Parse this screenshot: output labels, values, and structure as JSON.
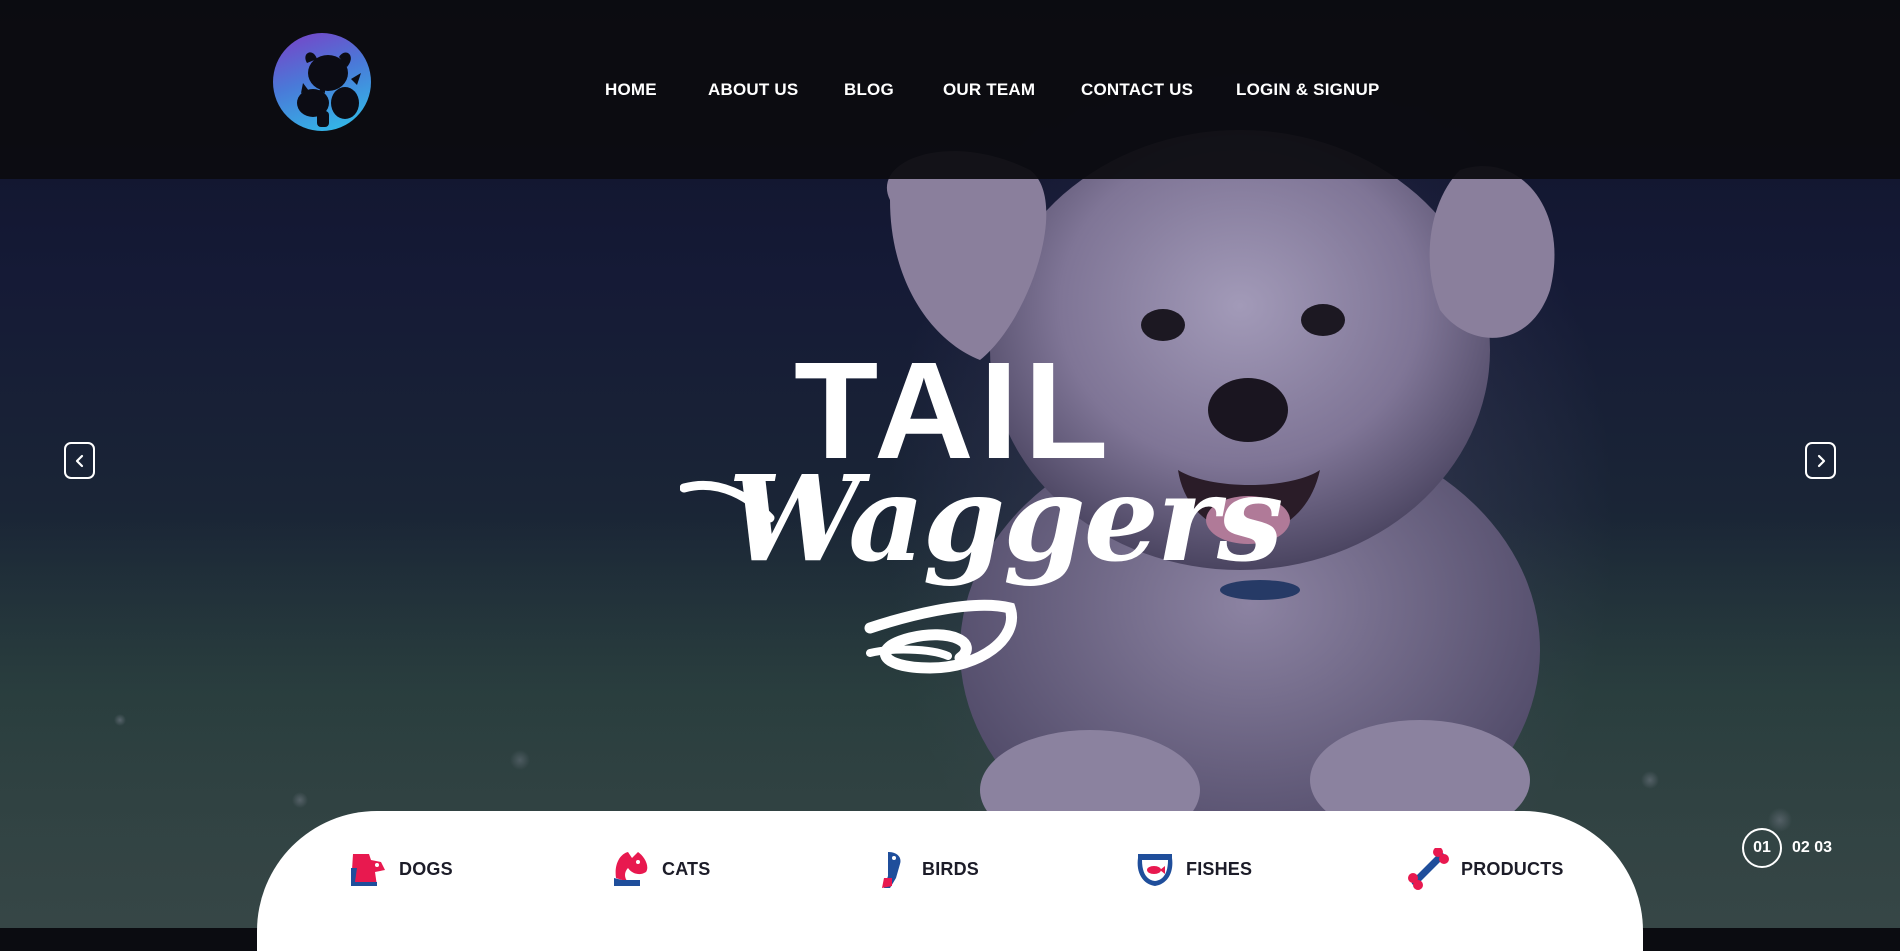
{
  "nav": {
    "items": [
      {
        "label": "HOME"
      },
      {
        "label": "ABOUT US"
      },
      {
        "label": "BLOG"
      },
      {
        "label": "OUR TEAM"
      },
      {
        "label": "CONTACT US"
      },
      {
        "label": "LOGIN & SIGNUP"
      }
    ]
  },
  "hero": {
    "title_top": "TAIL",
    "title_script": "Waggers",
    "prev_icon": "chevron-left-icon",
    "next_icon": "chevron-right-icon"
  },
  "categories": [
    {
      "label": "DOGS",
      "icon": "dog-icon"
    },
    {
      "label": "CATS",
      "icon": "cat-icon"
    },
    {
      "label": "BIRDS",
      "icon": "bird-icon"
    },
    {
      "label": "FISHES",
      "icon": "fish-bowl-icon"
    },
    {
      "label": "PRODUCTS",
      "icon": "bone-icon"
    }
  ],
  "pager": {
    "current": "01",
    "others": "02 03"
  },
  "colors": {
    "accent_pink": "#e8194f",
    "accent_blue": "#1f4e9b",
    "header_bg": "#0c0c10"
  }
}
